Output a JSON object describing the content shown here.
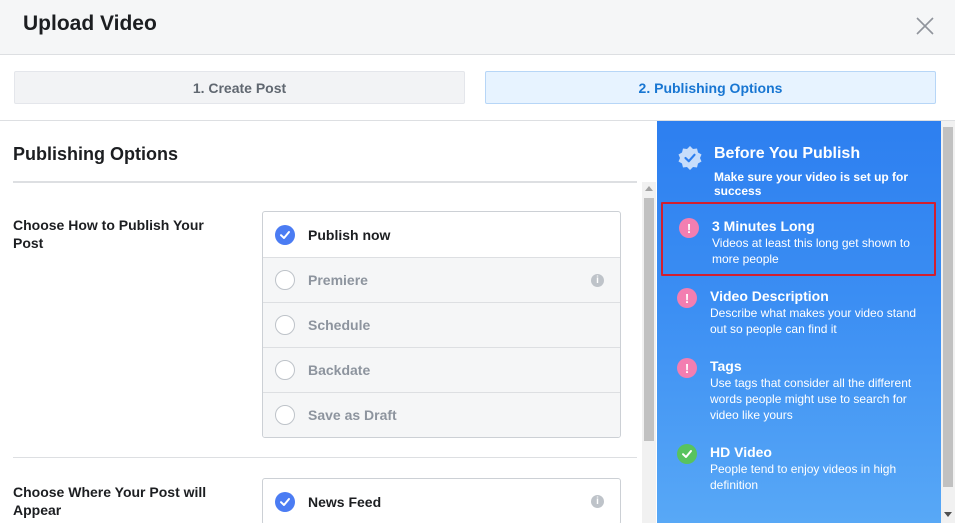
{
  "dialog": {
    "title": "Upload Video",
    "close_icon": "close-icon"
  },
  "steps": [
    {
      "label": "1. Create Post",
      "active": false
    },
    {
      "label": "2. Publishing Options",
      "active": true
    }
  ],
  "publishing": {
    "section_title": "Publishing Options",
    "how_label": "Choose How to Publish Your Post",
    "how_options": [
      {
        "label": "Publish now",
        "selected": true,
        "disabled": false
      },
      {
        "label": "Premiere",
        "selected": false,
        "disabled": true,
        "info": "info-icon"
      },
      {
        "label": "Schedule",
        "selected": false,
        "disabled": true
      },
      {
        "label": "Backdate",
        "selected": false,
        "disabled": true
      },
      {
        "label": "Save as Draft",
        "selected": false,
        "disabled": true
      }
    ],
    "where_label": "Choose Where Your Post will Appear",
    "where_options": [
      {
        "label": "News Feed",
        "selected": true,
        "info": "info-icon"
      }
    ]
  },
  "before_publish": {
    "title": "Before You Publish",
    "subtitle": "Make sure your video is set up for success",
    "tips": [
      {
        "name": "3 Minutes Long",
        "desc": "Videos at least this long get shown to more people",
        "status": "warning"
      },
      {
        "name": "Video Description",
        "desc": "Describe what makes your video stand out so people can find it",
        "status": "warning"
      },
      {
        "name": "Tags",
        "desc": "Use tags that consider all the different words people might use to search for video like yours",
        "status": "warning"
      },
      {
        "name": "HD Video",
        "desc": "People tend to enjoy videos in high definition",
        "status": "ok"
      }
    ]
  },
  "colors": {
    "accent": "#1876d2",
    "panel_blue": "#2d7ff0",
    "warning": "#f37eb1",
    "ok": "#58c35e",
    "highlight": "#d21f2f"
  }
}
